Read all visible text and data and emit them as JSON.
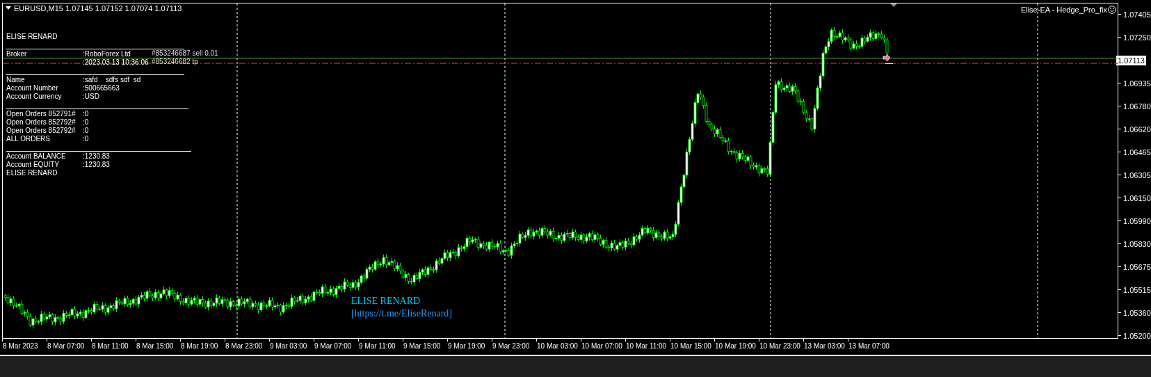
{
  "chart": {
    "title": "EURUSD,M15 1.07145 1.07152 1.07074 1.07113",
    "expert": "Elise-EA - Hedge_Pro_fix"
  },
  "info_panel": {
    "sections": [
      {
        "rows": [
          {
            "label": "ELISE RENARD"
          }
        ]
      },
      {
        "rows": [
          {
            "label": "Broker",
            "value": ":RoboForex Ltd"
          },
          {
            "value": ":2023.03.13 10:36:06"
          }
        ]
      },
      {
        "rows": [
          {
            "label": "Name",
            "value": ":safd    sdfs sdf  sd"
          },
          {
            "label": "Account Number",
            "value": ":500665663"
          },
          {
            "label": "Account Currency",
            "value": ":USD"
          }
        ]
      },
      {
        "rows": [
          {
            "label": "Open Orders 852791#",
            "value": ":0"
          },
          {
            "label": "Open Orders 852792#",
            "value": ":0"
          },
          {
            "label": "Open Orders 852792#",
            "value": ":0"
          },
          {
            "label": "ALL ORDERS",
            "value": ":0"
          }
        ]
      },
      {
        "rows": [
          {
            "label": "Account BALANCE",
            "value": ":1230.83"
          },
          {
            "label": "Account EQUITY",
            "value": ":1230.83"
          },
          {
            "label": "ELISE RENARD"
          }
        ]
      }
    ]
  },
  "trade_labels": [
    "#853246687 sell 0.01",
    "#853246682 tp"
  ],
  "signature": {
    "name": "ELISE RENARD",
    "link": "[https://t.me/EliseRenard]"
  },
  "price_axis": [
    {
      "kind": "tick",
      "label": "1.07405"
    },
    {
      "kind": "tick",
      "label": "1.07250"
    },
    {
      "kind": "current",
      "label": "1.07113"
    },
    {
      "kind": "tick",
      "label": "1.06935"
    },
    {
      "kind": "tick",
      "label": "1.06780"
    },
    {
      "kind": "tick",
      "label": "1.06620"
    },
    {
      "kind": "tick",
      "label": "1.06465"
    },
    {
      "kind": "tick",
      "label": "1.06305"
    },
    {
      "kind": "tick",
      "label": "1.06150"
    },
    {
      "kind": "tick",
      "label": "1.05990"
    },
    {
      "kind": "tick",
      "label": "1.05830"
    },
    {
      "kind": "tick",
      "label": "1.05675"
    },
    {
      "kind": "tick",
      "label": "1.05515"
    },
    {
      "kind": "tick",
      "label": "1.05360"
    },
    {
      "kind": "tick",
      "label": "1.05200"
    }
  ],
  "time_axis": [
    "8 Mar 2023",
    "8 Mar 07:00",
    "8 Mar 11:00",
    "8 Mar 15:00",
    "8 Mar 19:00",
    "8 Mar 23:00",
    "9 Mar 03:00",
    "9 Mar 07:00",
    "9 Mar 11:00",
    "9 Mar 15:00",
    "9 Mar 19:00",
    "9 Mar 23:00",
    "10 Mar 03:00",
    "10 Mar 07:00",
    "10 Mar 11:00",
    "10 Mar 15:00",
    "10 Mar 19:00",
    "10 Mar 23:00",
    "13 Mar 03:00",
    "13 Mar 07:00"
  ]
}
